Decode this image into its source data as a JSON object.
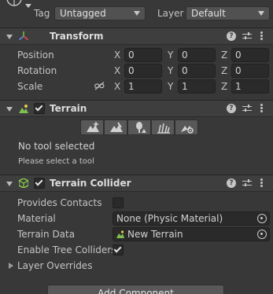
{
  "object": {
    "tag_label": "Tag",
    "tag_value": "Untagged",
    "layer_label": "Layer",
    "layer_value": "Default"
  },
  "transform": {
    "title": "Transform",
    "position_label": "Position",
    "rotation_label": "Rotation",
    "scale_label": "Scale",
    "axis_x": "X",
    "axis_y": "Y",
    "axis_z": "Z",
    "position": {
      "x": "0",
      "y": "0",
      "z": "0"
    },
    "rotation": {
      "x": "0",
      "y": "0",
      "z": "0"
    },
    "scale": {
      "x": "1",
      "y": "1",
      "z": "1"
    }
  },
  "terrain": {
    "title": "Terrain",
    "status": "No tool selected",
    "hint": "Please select a tool"
  },
  "terrain_collider": {
    "title": "Terrain Collider",
    "provides_contacts_label": "Provides Contacts",
    "material_label": "Material",
    "material_value": "None (Physic Material)",
    "terrain_data_label": "Terrain Data",
    "terrain_data_value": "New Terrain",
    "enable_tree_colliders_label": "Enable Tree Colliders",
    "layer_overrides_label": "Layer Overrides"
  },
  "add_component_label": "Add Component",
  "colors": {
    "background": "#383838",
    "header": "#3e3e3e",
    "field": "#2a2a2a",
    "terrain_collider_icon": "#8fd14f"
  }
}
